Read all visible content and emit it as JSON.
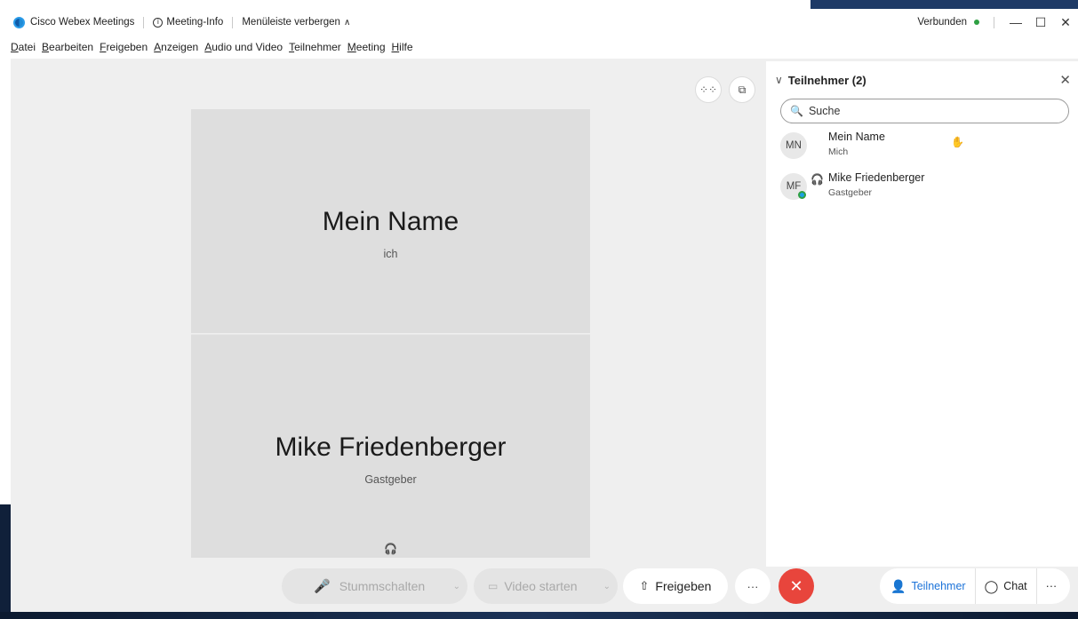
{
  "titlebar": {
    "app_name": "Cisco Webex Meetings",
    "meeting_info": "Meeting-Info",
    "hide_menubar": "Menüleiste verbergen",
    "connection_status": "Verbunden",
    "minimize": "—",
    "maximize": "☐",
    "close": "✕"
  },
  "menubar": {
    "items": [
      "Datei",
      "Bearbeiten",
      "Freigeben",
      "Anzeigen",
      "Audio und Video",
      "Teilnehmer",
      "Meeting",
      "Hilfe"
    ]
  },
  "stage": {
    "tiles": [
      {
        "name": "Mein Name",
        "role": "ich"
      },
      {
        "name": "Mike Friedenberger",
        "role": "Gastgeber"
      }
    ]
  },
  "controls": {
    "mute_label": "Stummschalten",
    "video_label": "Video starten",
    "share_label": "Freigeben",
    "more": "···",
    "end": "✕",
    "participants_label": "Teilnehmer",
    "chat_label": "Chat",
    "panel_more": "···"
  },
  "panel": {
    "title": "Teilnehmer (2)",
    "search_placeholder": "Suche",
    "participants": [
      {
        "initials": "MN",
        "name": "Mein Name",
        "sub": "Mich"
      },
      {
        "initials": "MF",
        "name": "Mike Friedenberger",
        "sub": "Gastgeber"
      }
    ]
  },
  "colors": {
    "accent": "#1c73d9",
    "end_call": "#e8453c",
    "connected": "#2ea043",
    "mic": "#27a844"
  },
  "icons": [
    "webex-logo-icon",
    "info-icon",
    "chevron-up-icon",
    "grid-layout-icon",
    "popout-icon",
    "headset-icon",
    "microphone-icon",
    "video-camera-icon",
    "share-icon",
    "more-icon",
    "end-call-icon",
    "participants-icon",
    "chat-icon",
    "search-icon",
    "close-icon",
    "chevron-down-icon",
    "raise-hand-icon"
  ]
}
